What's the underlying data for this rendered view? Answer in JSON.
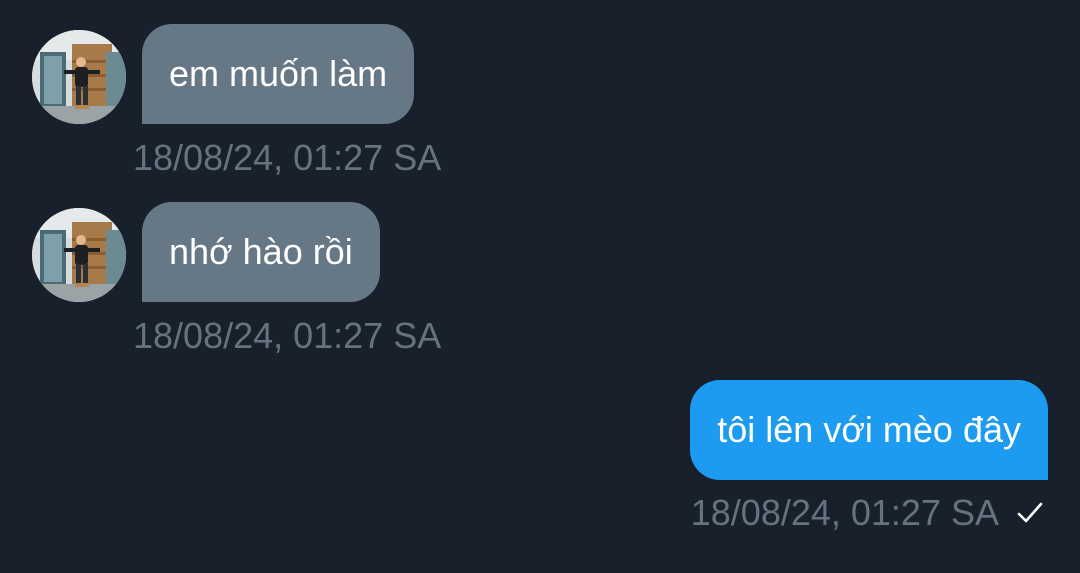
{
  "conversation": {
    "messages": [
      {
        "direction": "incoming",
        "text": "em muốn làm",
        "timestamp": "18/08/24, 01:27 SA",
        "avatar_icon": "user-avatar-photo"
      },
      {
        "direction": "incoming",
        "text": "nhớ hào rồi",
        "timestamp": "18/08/24, 01:27 SA",
        "avatar_icon": "user-avatar-photo"
      },
      {
        "direction": "outgoing",
        "text": "tôi lên với mèo đây",
        "timestamp": "18/08/24, 01:27 SA",
        "status_icon": "sent-check-icon"
      }
    ]
  },
  "colors": {
    "background": "#18202b",
    "incoming_bubble": "#667786",
    "outgoing_bubble": "#1d9bf0",
    "timestamp_text": "#66737f",
    "message_text": "#ffffff"
  }
}
